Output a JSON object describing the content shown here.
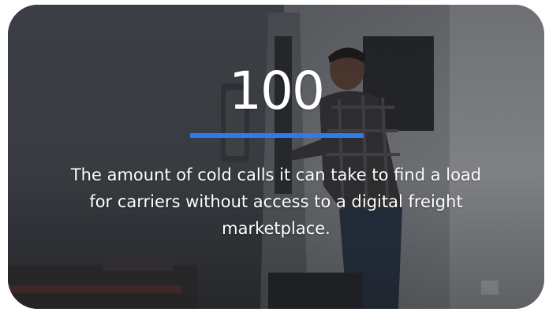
{
  "card": {
    "stat_value": "100",
    "description": "The amount of cold calls it can take to find a load for carriers without access to a digital freight marketplace.",
    "accent_color": "#2f7be8",
    "background_image": "truck-driver-photo"
  }
}
